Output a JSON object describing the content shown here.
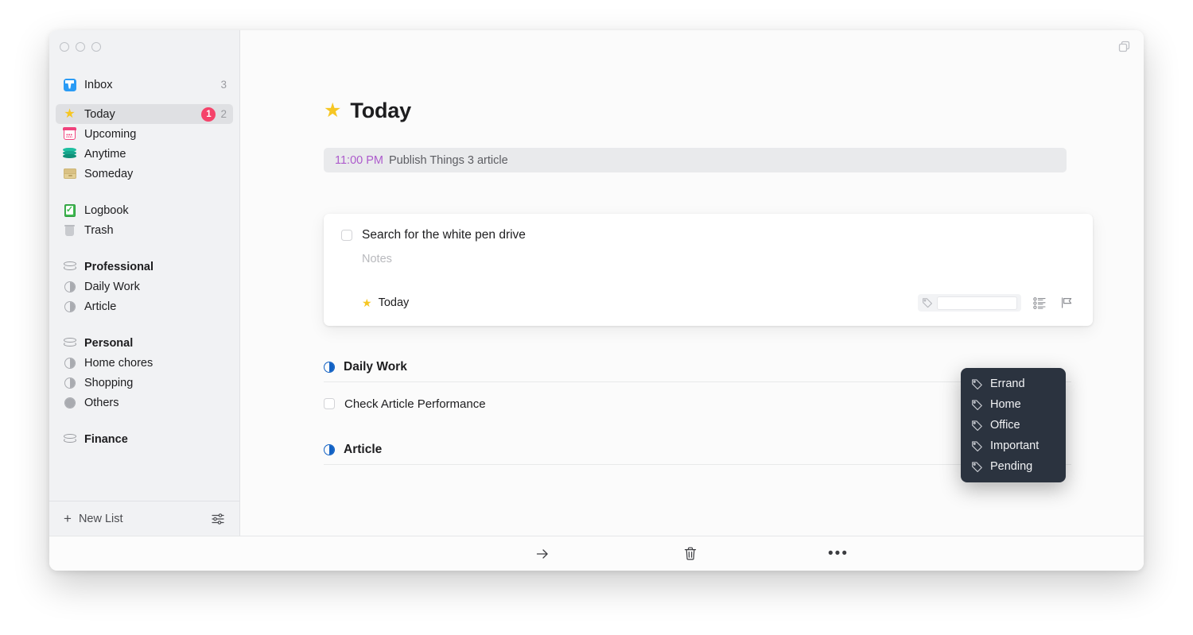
{
  "window": {
    "traffic_lights": [
      "close",
      "minimize",
      "zoom"
    ],
    "top_right_icon": "window-duplicate-icon"
  },
  "sidebar": {
    "items": [
      {
        "id": "inbox",
        "label": "Inbox",
        "icon": "inbox-tray-icon",
        "count": "3",
        "badge": null,
        "bold": false,
        "selected": false,
        "group": 0
      },
      {
        "id": "today",
        "label": "Today",
        "icon": "star-icon",
        "count": "2",
        "badge": "1",
        "bold": false,
        "selected": true,
        "group": 1
      },
      {
        "id": "upcoming",
        "label": "Upcoming",
        "icon": "calendar-icon",
        "count": null,
        "badge": null,
        "bold": false,
        "selected": false,
        "group": 1
      },
      {
        "id": "anytime",
        "label": "Anytime",
        "icon": "layers-icon",
        "count": null,
        "badge": null,
        "bold": false,
        "selected": false,
        "group": 1
      },
      {
        "id": "someday",
        "label": "Someday",
        "icon": "archive-box-icon",
        "count": null,
        "badge": null,
        "bold": false,
        "selected": false,
        "group": 1
      },
      {
        "id": "logbook",
        "label": "Logbook",
        "icon": "logbook-icon",
        "count": null,
        "badge": null,
        "bold": false,
        "selected": false,
        "group": 2
      },
      {
        "id": "trash",
        "label": "Trash",
        "icon": "trash-icon",
        "count": null,
        "badge": null,
        "bold": false,
        "selected": false,
        "group": 2
      },
      {
        "id": "professional",
        "label": "Professional",
        "icon": "area-icon",
        "count": null,
        "badge": null,
        "bold": true,
        "selected": false,
        "group": 3
      },
      {
        "id": "daily-work",
        "label": "Daily Work",
        "icon": "project-half-icon",
        "count": null,
        "badge": null,
        "bold": false,
        "selected": false,
        "group": 3
      },
      {
        "id": "article",
        "label": "Article",
        "icon": "project-half-icon",
        "count": null,
        "badge": null,
        "bold": false,
        "selected": false,
        "group": 3
      },
      {
        "id": "personal",
        "label": "Personal",
        "icon": "area-icon",
        "count": null,
        "badge": null,
        "bold": true,
        "selected": false,
        "group": 4
      },
      {
        "id": "home-chores",
        "label": "Home chores",
        "icon": "project-half-icon",
        "count": null,
        "badge": null,
        "bold": false,
        "selected": false,
        "group": 4
      },
      {
        "id": "shopping",
        "label": "Shopping",
        "icon": "project-half-icon",
        "count": null,
        "badge": null,
        "bold": false,
        "selected": false,
        "group": 4
      },
      {
        "id": "others",
        "label": "Others",
        "icon": "project-full-icon",
        "count": null,
        "badge": null,
        "bold": false,
        "selected": false,
        "group": 4
      },
      {
        "id": "finance",
        "label": "Finance",
        "icon": "area-icon",
        "count": null,
        "badge": null,
        "bold": true,
        "selected": false,
        "group": 5
      }
    ],
    "footer": {
      "new_list_label": "New List",
      "new_list_plus": "+",
      "settings_icon": "sliders-icon"
    }
  },
  "main": {
    "page_title": "Today",
    "page_title_icon": "star-icon",
    "reminder": {
      "time": "11:00 PM",
      "text": "Publish Things 3 article"
    },
    "task_card": {
      "checkbox_state": "unchecked",
      "title": "Search for the white pen drive",
      "notes_placeholder": "Notes",
      "when_icon": "star-icon",
      "when_label": "Today",
      "tag_input_value": "",
      "tag_icon": "tag-icon",
      "checklist_icon": "checklist-icon",
      "flag_icon": "flag-icon"
    },
    "tag_dropdown": {
      "options": [
        {
          "label": "Errand",
          "icon": "tag-icon"
        },
        {
          "label": "Home",
          "icon": "tag-icon"
        },
        {
          "label": "Office",
          "icon": "tag-icon"
        },
        {
          "label": "Important",
          "icon": "tag-icon"
        },
        {
          "label": "Pending",
          "icon": "tag-icon"
        }
      ]
    },
    "sections": [
      {
        "title": "Daily Work",
        "icon": "project-half-icon",
        "rows": [
          {
            "label": "Check Article Performance",
            "checkbox_state": "unchecked"
          }
        ]
      },
      {
        "title": "Article",
        "icon": "project-half-icon",
        "rows": []
      }
    ]
  },
  "bottom_bar": {
    "move_icon": "arrow-right-icon",
    "delete_icon": "trash-icon",
    "more_icon": "ellipsis-icon",
    "more_glyph": "•••"
  },
  "colors": {
    "accent_star": "#f6c623",
    "badge_red": "#f5436a",
    "reminder_time": "#ad5bcc",
    "project_blue": "#1161c4",
    "dropdown_bg": "#2b333f"
  }
}
